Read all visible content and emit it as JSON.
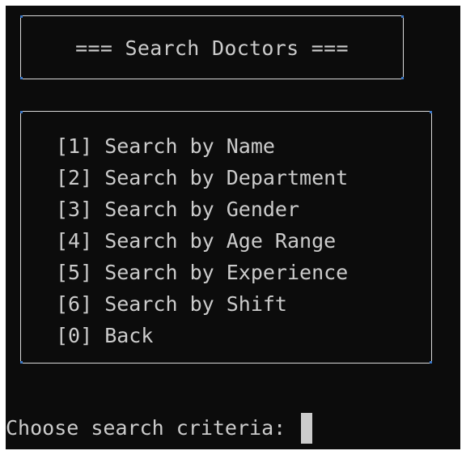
{
  "title_box": {
    "title": "=== Search Doctors ==="
  },
  "menu": {
    "items": [
      {
        "label": "[1] Search by Name"
      },
      {
        "label": "[2] Search by Department"
      },
      {
        "label": "[3] Search by Gender"
      },
      {
        "label": "[4] Search by Age Range"
      },
      {
        "label": "[5] Search by Experience"
      },
      {
        "label": "[6] Search by Shift"
      },
      {
        "label": "[0] Back"
      }
    ]
  },
  "prompt": {
    "text": "Choose search criteria: "
  },
  "colors": {
    "background": "#0c0c0c",
    "foreground": "#cccccc",
    "border": "#d9d9d9",
    "corner_accent": "#3b78c8"
  }
}
